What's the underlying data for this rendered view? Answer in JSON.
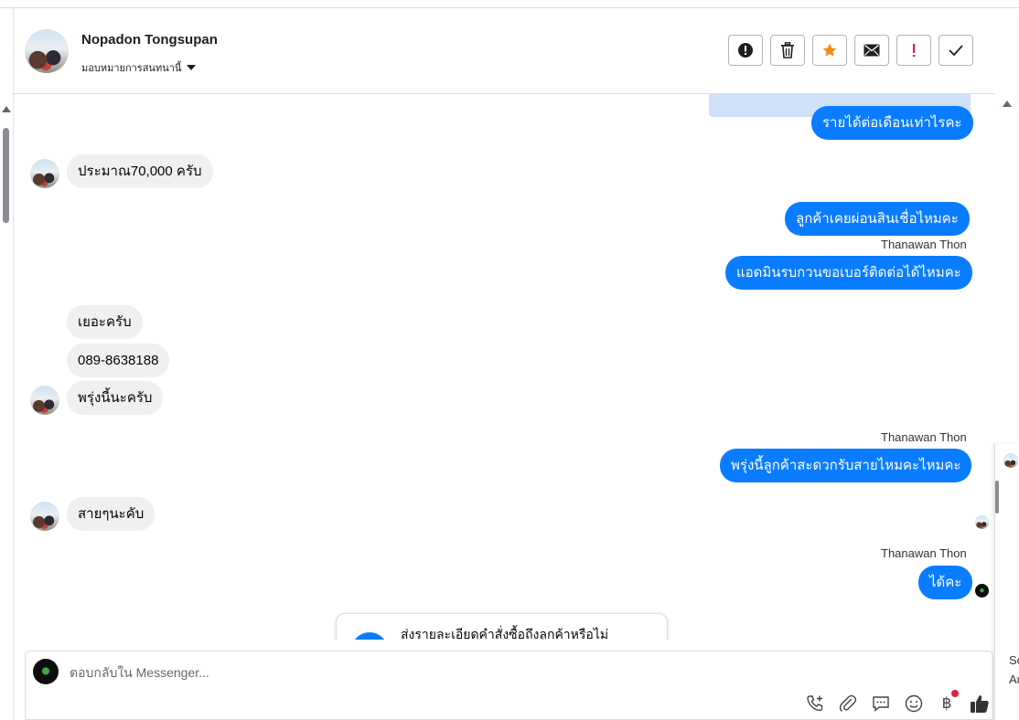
{
  "header": {
    "contact_name": "Nopadon Tongsupan",
    "assign_label": "มอบหมายการสนทนานี้",
    "actions": [
      {
        "name": "spam-button",
        "icon": "alert-circle-icon"
      },
      {
        "name": "delete-button",
        "icon": "trash-icon"
      },
      {
        "name": "star-button",
        "icon": "star-icon"
      },
      {
        "name": "mark-unread-button",
        "icon": "envelope-icon"
      },
      {
        "name": "follow-up-button",
        "icon": "exclamation-icon"
      },
      {
        "name": "done-button",
        "icon": "check-icon"
      }
    ]
  },
  "messages": {
    "m1": "รายได้ต่อเดือนเท่าไรคะ",
    "m2": "ประมาณ70,000 ครับ",
    "m3": "ลูกค้าเคยผ่อนสินเชื่อไหมคะ",
    "m4_sender": "Thanawan Thon",
    "m4": "แอดมินรบกวนขอเบอร์ติดต่อได้ไหมคะ",
    "m5": "เยอะครับ",
    "m6": "089-8638188",
    "m7": "พรุ่งนี้นะครับ",
    "m8_sender": "Thanawan Thon",
    "m8": "พรุ่งนี้ลูกค้าสะดวกรับสายไหมคะไหมคะ",
    "m9": "สายๆนะคับ",
    "m10_sender": "Thanawan Thon",
    "m10": "ได้คะ"
  },
  "card": {
    "text": "ส่งรายละเอียดคำสั่งซื้อถึงลูกค้าหรือไม่"
  },
  "composer": {
    "placeholder": "ตอบกลับใน Messenger...",
    "tools": [
      "phone-add-icon",
      "paperclip-icon",
      "saved-reply-icon",
      "emoji-icon",
      "baht-icon",
      "thumbs-up-icon"
    ],
    "baht_symbol": "฿"
  },
  "side_panel": {
    "line1": "Sc",
    "line2": "Au"
  },
  "colors": {
    "outgoing_bubble": "#0a7cff",
    "incoming_bubble": "#f0f0f0",
    "star": "#f28b1f",
    "alert_red": "#e41e3f"
  }
}
